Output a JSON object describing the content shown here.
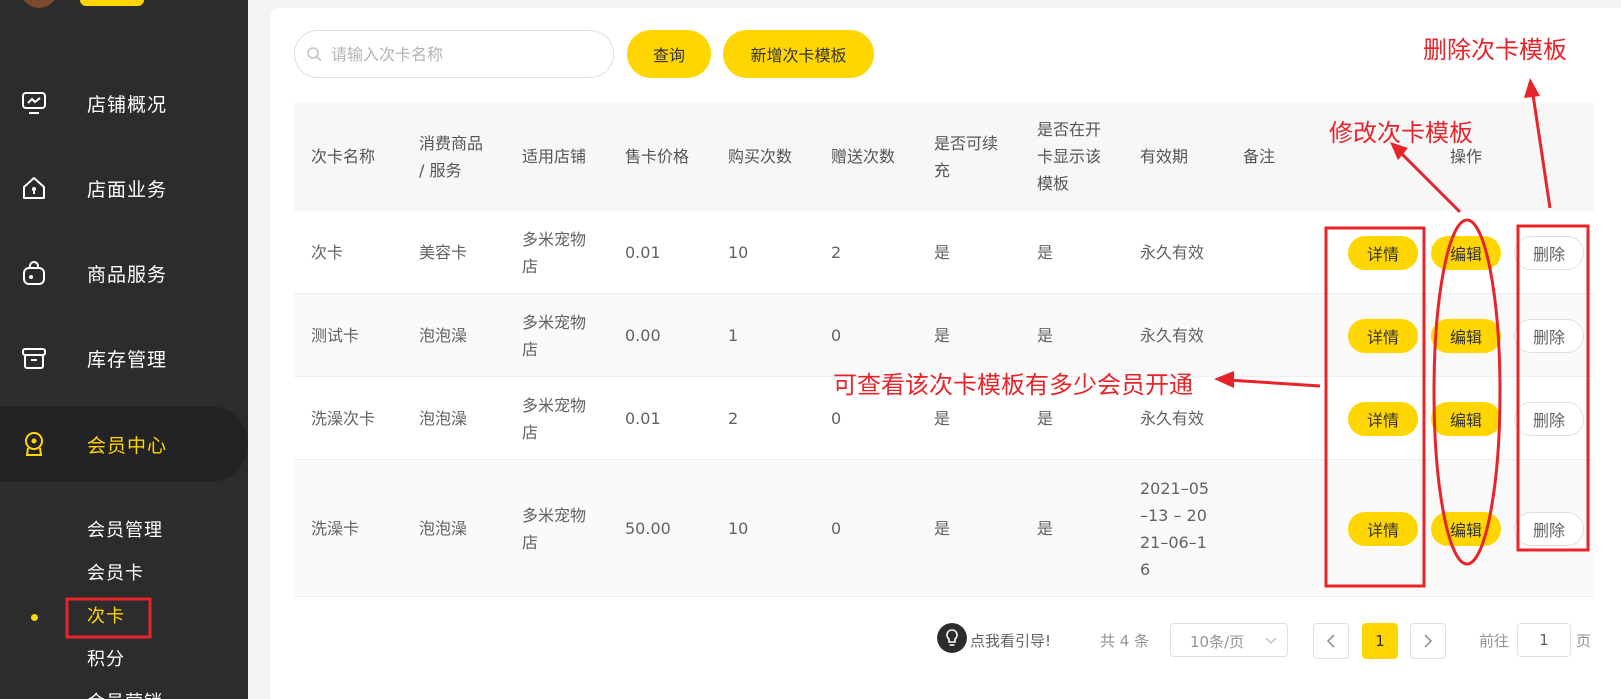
{
  "sidebar": {
    "menu": [
      {
        "label": "店铺概况",
        "icon": "monitor-icon"
      },
      {
        "label": "店面业务",
        "icon": "home-icon"
      },
      {
        "label": "商品服务",
        "icon": "bag-icon"
      },
      {
        "label": "库存管理",
        "icon": "box-icon"
      },
      {
        "label": "会员中心",
        "icon": "member-icon"
      }
    ],
    "submenu": [
      "会员管理",
      "会员卡",
      "次卡",
      "积分",
      "会员营销"
    ]
  },
  "toolbar": {
    "search_placeholder": "请输入次卡名称",
    "query_label": "查询",
    "add_label": "新增次卡模板"
  },
  "table": {
    "headers": [
      [
        "次卡名称"
      ],
      [
        "消费商品",
        "/ 服务"
      ],
      [
        "适用店铺"
      ],
      [
        "售卡价格"
      ],
      [
        "购买次数"
      ],
      [
        "赠送次数"
      ],
      [
        "是否可续",
        "充"
      ],
      [
        "是否在开",
        "卡显示该",
        "模板"
      ],
      [
        "有效期"
      ],
      [
        "备注"
      ],
      [
        "操作"
      ]
    ],
    "rows": [
      {
        "name": "次卡",
        "service": "美容卡",
        "store": [
          "多米宠物",
          "店"
        ],
        "price": "0.01",
        "buy": "10",
        "gift": "2",
        "renew": "是",
        "show": "是",
        "validity": [
          "永久有效"
        ],
        "remark": ""
      },
      {
        "name": "测试卡",
        "service": "泡泡澡",
        "store": [
          "多米宠物",
          "店"
        ],
        "price": "0.00",
        "buy": "1",
        "gift": "0",
        "renew": "是",
        "show": "是",
        "validity": [
          "永久有效"
        ],
        "remark": ""
      },
      {
        "name": "洗澡次卡",
        "service": "泡泡澡",
        "store": [
          "多米宠物",
          "店"
        ],
        "price": "0.01",
        "buy": "2",
        "gift": "0",
        "renew": "是",
        "show": "是",
        "validity": [
          "永久有效"
        ],
        "remark": ""
      },
      {
        "name": "洗澡卡",
        "service": "泡泡澡",
        "store": [
          "多米宠物",
          "店"
        ],
        "price": "50.00",
        "buy": "10",
        "gift": "0",
        "renew": "是",
        "show": "是",
        "validity": [
          "2021–05",
          "–13 – 20",
          "21–06–1",
          "6"
        ],
        "remark": ""
      }
    ],
    "actions": {
      "detail": "详情",
      "edit": "编辑",
      "delete": "删除"
    }
  },
  "pagination": {
    "guide": "点我看引导!",
    "total": "共 4 条",
    "page_size": "10条/页",
    "current": "1",
    "goto_prefix": "前往",
    "goto_value": "1",
    "goto_suffix": "页"
  },
  "annotations": {
    "delete": "删除次卡模板",
    "edit": "修改次卡模板",
    "detail": "可查看该次卡模板有多少会员开通"
  },
  "colors": {
    "accent": "#ffd600",
    "sidebar": "#2c2c2e",
    "annotation": "#e8242b"
  }
}
